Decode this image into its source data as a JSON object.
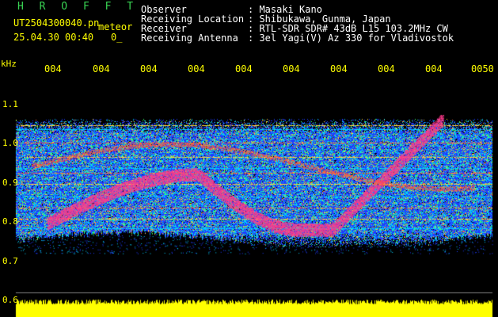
{
  "app_title": "H R O F F T",
  "file": {
    "name": "UT2504300040.pn",
    "tag": "meteor",
    "datetime": "25.04.30 00:40",
    "index": "0_"
  },
  "info": {
    "labels": [
      "Observer",
      "Receiving Location",
      "Receiver",
      "Receiving Antenna"
    ],
    "values": [
      ": Masaki Kano",
      ": Shibukawa, Gunma, Japan",
      ": RTL-SDR SDR# 43dB L15 103.2MHz CW",
      ": 3el Yagi(V) Az 330 for Vladivostok"
    ]
  },
  "axis": {
    "unit": "kHz",
    "y_ticks": [
      "1.1",
      "1.0",
      "0.9",
      "0.8",
      "0.7",
      "0.6"
    ],
    "x_ticks": [
      "004",
      "004",
      "004",
      "004",
      "004",
      "004",
      "004",
      "004",
      "004",
      "0050"
    ]
  },
  "colors": {
    "background": "#000000",
    "header_text": "#ffffff",
    "title_green": "#39d353",
    "tick_yellow": "#ffff00",
    "echo_pink": "#ff3c8c",
    "noise_blue": "#1f3cff",
    "noise_cyan": "#00d0ff",
    "noise_green": "#3cff6a",
    "level_bar": "#ffff00"
  }
}
